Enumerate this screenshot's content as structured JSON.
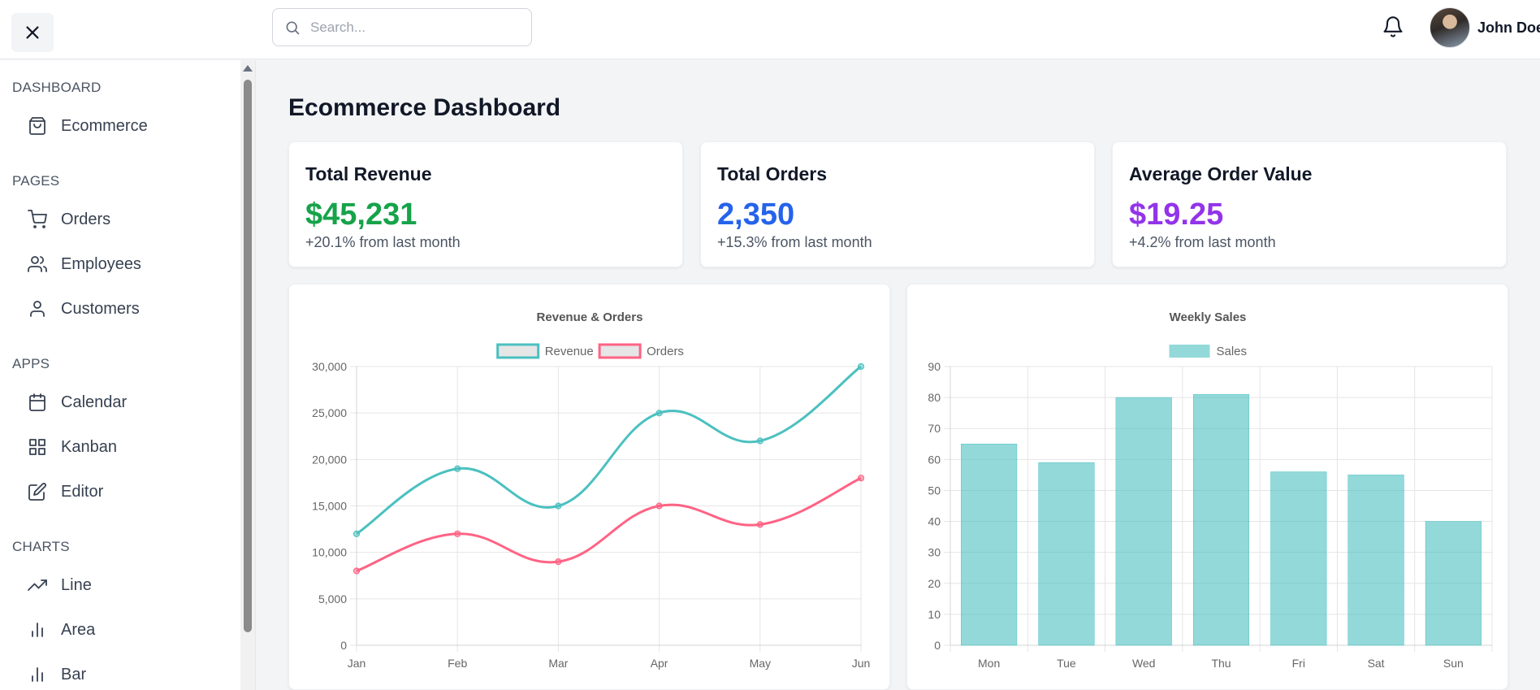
{
  "header": {
    "search_placeholder": "Search...",
    "user_name": "John Doe"
  },
  "sidebar": {
    "sections": [
      {
        "title": "DASHBOARD",
        "items": [
          {
            "label": "Ecommerce",
            "icon": "shopping-bag-icon"
          }
        ]
      },
      {
        "title": "PAGES",
        "items": [
          {
            "label": "Orders",
            "icon": "shopping-cart-icon"
          },
          {
            "label": "Employees",
            "icon": "users-icon"
          },
          {
            "label": "Customers",
            "icon": "user-icon"
          }
        ]
      },
      {
        "title": "APPS",
        "items": [
          {
            "label": "Calendar",
            "icon": "calendar-icon"
          },
          {
            "label": "Kanban",
            "icon": "grid-icon"
          },
          {
            "label": "Editor",
            "icon": "edit-icon"
          }
        ]
      },
      {
        "title": "CHARTS",
        "items": [
          {
            "label": "Line",
            "icon": "trending-up-icon"
          },
          {
            "label": "Area",
            "icon": "bar-chart-icon"
          },
          {
            "label": "Bar",
            "icon": "bar-chart-icon"
          }
        ]
      }
    ]
  },
  "main": {
    "title": "Ecommerce Dashboard",
    "cards": [
      {
        "title": "Total Revenue",
        "value": "$45,231",
        "subtitle": "+20.1% from last month",
        "color": "#16a34a"
      },
      {
        "title": "Total Orders",
        "value": "2,350",
        "subtitle": "+15.3% from last month",
        "color": "#2563eb"
      },
      {
        "title": "Average Order Value",
        "value": "$19.25",
        "subtitle": "+4.2% from last month",
        "color": "#9333ea"
      }
    ]
  },
  "chart_data": [
    {
      "type": "line",
      "title": "Revenue & Orders",
      "categories": [
        "Jan",
        "Feb",
        "Mar",
        "Apr",
        "May",
        "Jun"
      ],
      "series": [
        {
          "name": "Revenue",
          "values": [
            12000,
            19000,
            15000,
            25000,
            22000,
            30000
          ],
          "color": "#4bc0c0"
        },
        {
          "name": "Orders",
          "values": [
            8000,
            12000,
            9000,
            15000,
            13000,
            18000
          ],
          "color": "#ff6384"
        }
      ],
      "yticks": [
        "0",
        "5,000",
        "10,000",
        "15,000",
        "20,000",
        "25,000",
        "30,000"
      ],
      "ylim": [
        0,
        30000
      ],
      "legend": "top",
      "grid": true
    },
    {
      "type": "bar",
      "title": "Weekly Sales",
      "categories": [
        "Mon",
        "Tue",
        "Wed",
        "Thu",
        "Fri",
        "Sat",
        "Sun"
      ],
      "series": [
        {
          "name": "Sales",
          "values": [
            65,
            59,
            80,
            81,
            56,
            55,
            40
          ],
          "color": "#4bc0c0"
        }
      ],
      "yticks": [
        "0",
        "10",
        "20",
        "30",
        "40",
        "50",
        "60",
        "70",
        "80",
        "90"
      ],
      "ylim": [
        0,
        90
      ],
      "legend": "top",
      "grid": true
    }
  ]
}
